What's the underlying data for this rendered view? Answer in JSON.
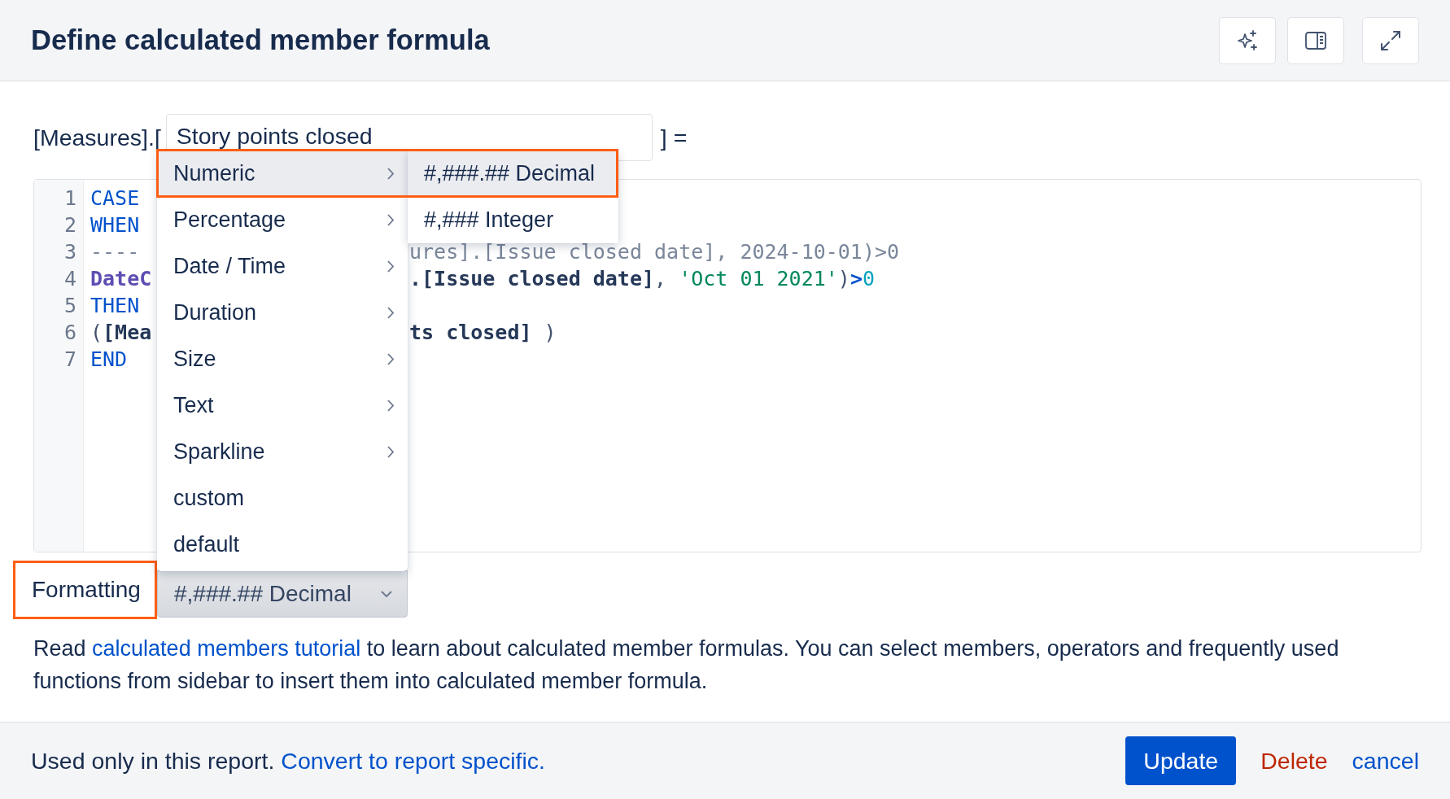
{
  "dialog": {
    "title": "Define calculated member formula"
  },
  "header_buttons": [
    {
      "kind": "sparkle"
    },
    {
      "kind": "panel"
    },
    {
      "kind": "expand"
    }
  ],
  "member": {
    "prefix": "[Measures].[",
    "value": "Story points closed",
    "suffix": "] ="
  },
  "code_lines": [
    {
      "number": "1",
      "left": [
        {
          "text": "CASE",
          "kind": "keyword"
        }
      ]
    },
    {
      "number": "2",
      "left": [
        {
          "text": "WHEN",
          "kind": "keyword"
        }
      ]
    },
    {
      "number": "3",
      "left": [
        {
          "text": "----",
          "kind": "comment"
        }
      ],
      "right": [
        {
          "text": "ures].[Issue closed date], 2024-10-01)>0",
          "kind": "comment"
        }
      ]
    },
    {
      "number": "4",
      "left": [
        {
          "text": "DateC",
          "kind": "function"
        }
      ],
      "right": [
        {
          "text": ".[Issue closed date]",
          "kind": "member"
        },
        {
          "text": ", ",
          "kind": "plain"
        },
        {
          "text": "'Oct 01 2021'",
          "kind": "string"
        },
        {
          "text": ")",
          "kind": "plain"
        },
        {
          "text": ">",
          "kind": "operator"
        },
        {
          "text": "0",
          "kind": "number"
        }
      ]
    },
    {
      "number": "5",
      "left": [
        {
          "text": "THEN",
          "kind": "keyword"
        }
      ]
    },
    {
      "number": "6",
      "left": [
        {
          "text": "(",
          "kind": "plain"
        },
        {
          "text": "[Mea",
          "kind": "member"
        }
      ],
      "right": [
        {
          "text": "ts closed]",
          "kind": "member"
        },
        {
          "text": " )",
          "kind": "plain"
        }
      ]
    },
    {
      "number": "7",
      "left": [
        {
          "text": "END",
          "kind": "keyword"
        }
      ]
    }
  ],
  "format_menu": {
    "items": [
      {
        "label": "Numeric",
        "has_submenu": true,
        "selected": true,
        "highlighted": true
      },
      {
        "label": "Percentage",
        "has_submenu": true,
        "selected": false,
        "highlighted": false
      },
      {
        "label": "Date / Time",
        "has_submenu": true,
        "selected": false,
        "highlighted": false
      },
      {
        "label": "Duration",
        "has_submenu": true,
        "selected": false,
        "highlighted": false
      },
      {
        "label": "Size",
        "has_submenu": true,
        "selected": false,
        "highlighted": false
      },
      {
        "label": "Text",
        "has_submenu": true,
        "selected": false,
        "highlighted": false
      },
      {
        "label": "Sparkline",
        "has_submenu": true,
        "selected": false,
        "highlighted": false
      },
      {
        "label": "custom",
        "has_submenu": false,
        "selected": false,
        "highlighted": false
      },
      {
        "label": "default",
        "has_submenu": false,
        "selected": false,
        "highlighted": false
      }
    ],
    "submenu": [
      {
        "label": "#,###.## Decimal",
        "selected": true
      },
      {
        "label": "#,### Integer",
        "selected": false
      }
    ]
  },
  "formatting": {
    "label": "Formatting",
    "highlighted": true,
    "value": "#,###.## Decimal"
  },
  "help_text": [
    {
      "text": "Read ",
      "kind": "text"
    },
    {
      "text": "calculated members tutorial",
      "kind": "link"
    },
    {
      "text": " to learn about calculated member formulas. You can select members, operators and frequently used functions from sidebar to insert them into calculated member formula.",
      "kind": "text"
    }
  ],
  "footer": {
    "note": [
      {
        "text": "Used only in this report. ",
        "kind": "text"
      },
      {
        "text": "Convert to report specific.",
        "kind": "link"
      }
    ],
    "buttons": [
      {
        "label": "Update",
        "kind": "primary"
      },
      {
        "label": "Delete",
        "kind": "danger"
      },
      {
        "label": "cancel",
        "kind": "link"
      }
    ]
  }
}
